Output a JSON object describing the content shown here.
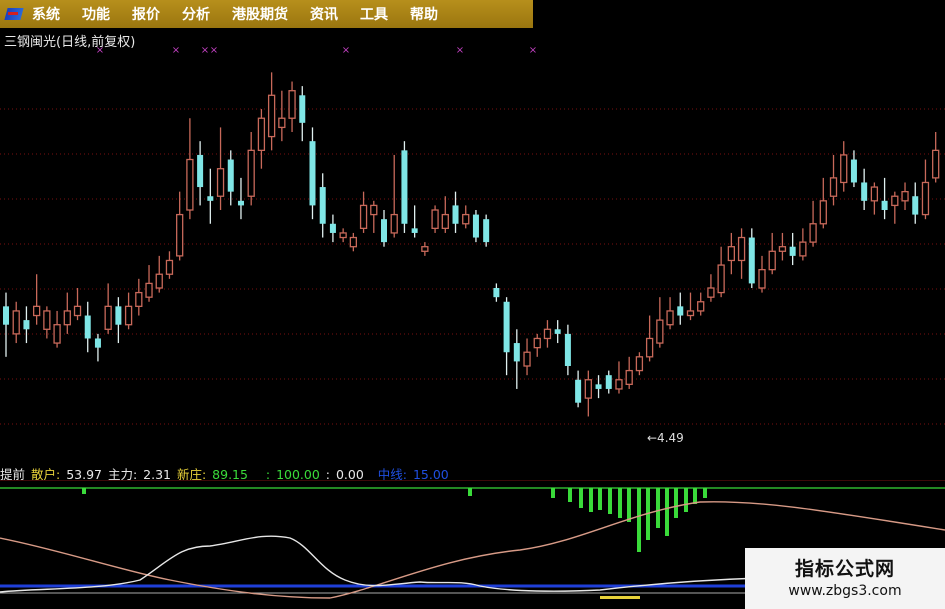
{
  "menu": [
    "系统",
    "功能",
    "报价",
    "分析",
    "港股期货",
    "资讯",
    "工具",
    "帮助"
  ],
  "title": "三钢闽光(日线,前复权)",
  "low_label": "←4.49",
  "indicators": [
    {
      "label": "提前",
      "value": "",
      "color": "#e8e8e8"
    },
    {
      "label": "散户: ",
      "value": "53.97",
      "color": "#e8e8e8"
    },
    {
      "label": "主力: ",
      "value": "2.31",
      "color": "#e8e8e8"
    },
    {
      "label": "新庄: ",
      "value": "89.15",
      "color": "#3adb3a"
    },
    {
      "label": ": ",
      "value": "100.00",
      "color": "#3adb3a"
    },
    {
      "label": ": ",
      "value": "0.00",
      "color": "#e8e8e8"
    },
    {
      "label": "中线: ",
      "value": "15.00",
      "color": "#1f4fe0"
    }
  ],
  "watermark": {
    "title": "指标公式网",
    "url": "www.zbgs3.com"
  },
  "colors": {
    "up": "#c8695a",
    "down": "#7fe6e6",
    "grid": "#7a1010",
    "marker": "#c040c0"
  },
  "chart_data": {
    "type": "candlestick",
    "low_price": 4.49,
    "candles": [
      [
        7,
        6.6,
        7.3,
        5.9
      ],
      [
        6.4,
        6.9,
        7.1,
        6.2
      ],
      [
        6.7,
        6.5,
        7.0,
        6.2
      ],
      [
        6.8,
        7.0,
        7.7,
        6.6
      ],
      [
        6.5,
        6.9,
        7.0,
        6.3
      ],
      [
        6.2,
        6.6,
        6.9,
        6.1
      ],
      [
        6.6,
        6.9,
        7.3,
        6.4
      ],
      [
        6.8,
        7.0,
        7.4,
        6.7
      ],
      [
        6.8,
        6.3,
        7.1,
        6.0
      ],
      [
        6.3,
        6.1,
        6.4,
        5.8
      ],
      [
        6.5,
        7.0,
        7.5,
        6.4
      ],
      [
        7.0,
        6.6,
        7.2,
        6.2
      ],
      [
        6.6,
        7.0,
        7.3,
        6.5
      ],
      [
        7.0,
        7.3,
        7.6,
        6.8
      ],
      [
        7.2,
        7.5,
        7.9,
        7.1
      ],
      [
        7.4,
        7.7,
        8.1,
        7.3
      ],
      [
        7.7,
        8.0,
        8.2,
        7.6
      ],
      [
        8.1,
        9.0,
        9.5,
        8.0
      ],
      [
        9.1,
        10.2,
        11.1,
        8.9
      ],
      [
        10.3,
        9.6,
        10.6,
        9.2
      ],
      [
        9.4,
        9.3,
        10.0,
        8.8
      ],
      [
        9.4,
        10.0,
        10.9,
        9.1
      ],
      [
        10.2,
        9.5,
        10.4,
        9.2
      ],
      [
        9.3,
        9.2,
        9.8,
        8.9
      ],
      [
        9.4,
        10.4,
        10.8,
        9.2
      ],
      [
        10.4,
        11.1,
        11.3,
        10.0
      ],
      [
        10.7,
        11.6,
        12.1,
        10.4
      ],
      [
        10.9,
        11.1,
        11.7,
        10.6
      ],
      [
        11.1,
        11.7,
        11.9,
        10.8
      ],
      [
        11.6,
        11.0,
        11.8,
        10.6
      ],
      [
        10.6,
        9.2,
        10.9,
        8.9
      ],
      [
        9.6,
        8.8,
        9.9,
        8.5
      ],
      [
        8.8,
        8.6,
        9.0,
        8.4
      ],
      [
        8.5,
        8.6,
        8.7,
        8.4
      ],
      [
        8.3,
        8.5,
        8.6,
        8.2
      ],
      [
        8.7,
        9.2,
        9.5,
        8.6
      ],
      [
        9.0,
        9.2,
        9.3,
        8.6
      ],
      [
        8.9,
        8.4,
        9.1,
        8.3
      ],
      [
        8.6,
        9.0,
        10.3,
        8.5
      ],
      [
        10.4,
        8.8,
        10.6,
        8.6
      ],
      [
        8.7,
        8.6,
        9.2,
        8.5
      ],
      [
        8.2,
        8.3,
        8.4,
        8.1
      ],
      [
        8.7,
        9.1,
        9.2,
        8.6
      ],
      [
        8.7,
        9.0,
        9.4,
        8.6
      ],
      [
        9.2,
        8.8,
        9.5,
        8.6
      ],
      [
        8.8,
        9.0,
        9.2,
        8.7
      ],
      [
        9.0,
        8.5,
        9.1,
        8.4
      ],
      [
        8.9,
        8.4,
        9.0,
        8.3
      ],
      [
        7.4,
        7.2,
        7.5,
        7.1
      ],
      [
        7.1,
        6.0,
        7.2,
        5.5
      ],
      [
        6.2,
        5.8,
        6.5,
        5.2
      ],
      [
        5.7,
        6.0,
        6.3,
        5.5
      ],
      [
        6.1,
        6.3,
        6.4,
        5.9
      ],
      [
        6.3,
        6.5,
        6.7,
        6.1
      ],
      [
        6.5,
        6.4,
        6.7,
        6.2
      ],
      [
        6.4,
        5.7,
        6.6,
        5.5
      ],
      [
        5.4,
        4.9,
        5.6,
        4.8
      ],
      [
        5.0,
        5.4,
        5.6,
        4.6
      ],
      [
        5.3,
        5.2,
        5.5,
        5.0
      ],
      [
        5.5,
        5.2,
        5.6,
        5.1
      ],
      [
        5.2,
        5.4,
        5.8,
        5.1
      ],
      [
        5.3,
        5.6,
        5.9,
        5.2
      ],
      [
        5.6,
        5.9,
        6.0,
        5.5
      ],
      [
        5.9,
        6.3,
        6.8,
        5.8
      ],
      [
        6.2,
        6.7,
        7.2,
        6.1
      ],
      [
        6.6,
        6.9,
        7.2,
        6.5
      ],
      [
        7.0,
        6.8,
        7.3,
        6.6
      ],
      [
        6.8,
        6.9,
        7.3,
        6.7
      ],
      [
        6.9,
        7.1,
        7.3,
        6.8
      ],
      [
        7.2,
        7.4,
        7.7,
        7.1
      ],
      [
        7.3,
        7.9,
        8.3,
        7.2
      ],
      [
        8.0,
        8.3,
        8.6,
        7.7
      ],
      [
        8.0,
        8.5,
        8.7,
        7.6
      ],
      [
        8.5,
        7.5,
        8.7,
        7.4
      ],
      [
        7.4,
        7.8,
        8.1,
        7.3
      ],
      [
        7.8,
        8.2,
        8.6,
        7.7
      ],
      [
        8.2,
        8.3,
        8.6,
        8.0
      ],
      [
        8.3,
        8.1,
        8.6,
        7.9
      ],
      [
        8.1,
        8.4,
        8.7,
        8.0
      ],
      [
        8.4,
        8.8,
        9.3,
        8.3
      ],
      [
        8.8,
        9.3,
        9.8,
        8.7
      ],
      [
        9.4,
        9.8,
        10.3,
        9.2
      ],
      [
        9.7,
        10.3,
        10.6,
        9.5
      ],
      [
        10.2,
        9.7,
        10.4,
        9.6
      ],
      [
        9.7,
        9.3,
        10.0,
        9.1
      ],
      [
        9.3,
        9.6,
        9.7,
        9.0
      ],
      [
        9.3,
        9.1,
        9.8,
        8.9
      ],
      [
        9.2,
        9.4,
        9.5,
        8.8
      ],
      [
        9.3,
        9.5,
        9.7,
        9.1
      ],
      [
        9.4,
        9.0,
        9.7,
        8.8
      ],
      [
        9.0,
        9.7,
        10.2,
        8.9
      ],
      [
        9.8,
        10.4,
        10.8,
        9.7
      ]
    ]
  }
}
